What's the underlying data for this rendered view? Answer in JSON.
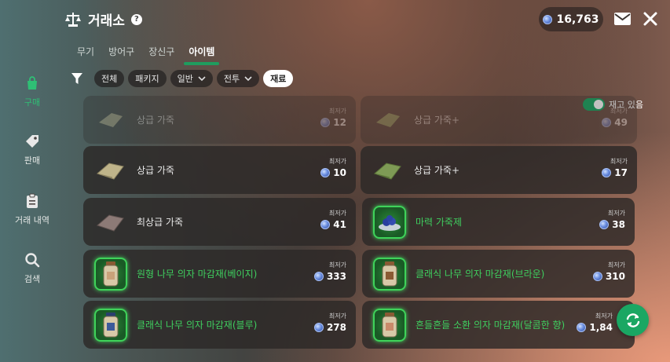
{
  "header": {
    "title": "거래소",
    "currency_amount": "16,763"
  },
  "tabs": [
    {
      "label": "무기"
    },
    {
      "label": "방어구"
    },
    {
      "label": "장신구"
    },
    {
      "label": "아이템",
      "active": true
    }
  ],
  "filters": {
    "chips": [
      {
        "label": "전체",
        "dropdown": false,
        "selected": false
      },
      {
        "label": "패키지",
        "dropdown": false,
        "selected": false
      },
      {
        "label": "일반",
        "dropdown": true,
        "selected": false
      },
      {
        "label": "전투",
        "dropdown": true,
        "selected": false
      },
      {
        "label": "재료",
        "dropdown": false,
        "selected": true
      }
    ],
    "stock_toggle_label": "재고 있음",
    "stock_toggle_on": true
  },
  "sidebar": {
    "items": [
      {
        "label": "구매",
        "icon": "shopping-bag-icon",
        "active": true
      },
      {
        "label": "판매",
        "icon": "price-tag-icon",
        "active": false
      },
      {
        "label": "거래 내역",
        "icon": "clipboard-icon",
        "active": false
      },
      {
        "label": "검색",
        "icon": "search-icon",
        "active": false
      }
    ]
  },
  "items": [
    {
      "name": "상급 가죽",
      "price_label": "최저가",
      "price": "12",
      "icon": "leather-icon",
      "faded": true,
      "green": false
    },
    {
      "name": "상급 가죽+",
      "price_label": "최저가",
      "price": "49",
      "icon": "leather-green-icon",
      "faded": true,
      "green": false
    },
    {
      "name": "상급 가죽",
      "price_label": "최저가",
      "price": "10",
      "icon": "leather-icon",
      "faded": false,
      "green": false
    },
    {
      "name": "상급 가죽+",
      "price_label": "최저가",
      "price": "17",
      "icon": "leather-green-icon",
      "faded": false,
      "green": false
    },
    {
      "name": "최상급 가죽",
      "price_label": "최저가",
      "price": "41",
      "icon": "leather-gray-icon",
      "faded": false,
      "green": false
    },
    {
      "name": "마력 가죽제",
      "price_label": "최저가",
      "price": "38",
      "icon": "magic-ore-icon",
      "faded": false,
      "green": true
    },
    {
      "name": "원형 나무 의자 마감재(베이지)",
      "price_label": "최저가",
      "price": "333",
      "icon": "jar-icon",
      "faded": false,
      "green": true
    },
    {
      "name": "클래식 나무 의자 마감재(브라운)",
      "price_label": "최저가",
      "price": "310",
      "icon": "jar-icon",
      "faded": false,
      "green": true
    },
    {
      "name": "클래식 나무 의자 마감재(블루)",
      "price_label": "최저가",
      "price": "278",
      "icon": "jar-blue-icon",
      "faded": false,
      "green": true
    },
    {
      "name": "흔들흔들 소환 의자 마감재(달콤한 향)",
      "price_label": "최저가",
      "price": "1,84",
      "icon": "jar-icon",
      "faded": false,
      "green": true
    }
  ],
  "colors": {
    "accent": "#1aa763",
    "item_green": "#3fcf5f"
  }
}
